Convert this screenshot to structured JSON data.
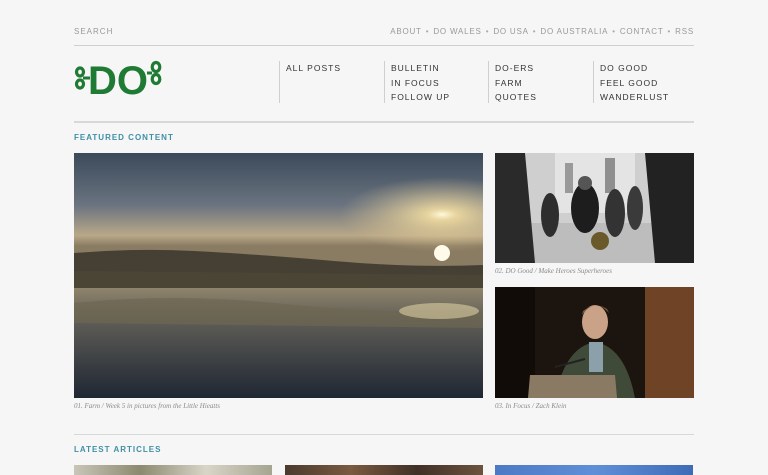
{
  "header": {
    "search_label": "SEARCH",
    "topnav": [
      "ABOUT",
      "DO WALES",
      "DO USA",
      "DO AUSTRALIA",
      "CONTACT",
      "RSS"
    ],
    "separator": "•"
  },
  "logo": {
    "text": "DO",
    "color": "#1f7a34"
  },
  "nav": {
    "col1": [
      "ALL POSTS"
    ],
    "col2": [
      "BULLETIN",
      "IN FOCUS",
      "FOLLOW UP"
    ],
    "col3": [
      "DO-ERS",
      "FARM",
      "QUOTES"
    ],
    "col4": [
      "DO GOOD",
      "FEEL GOOD",
      "WANDERLUST"
    ]
  },
  "featured": {
    "title": "FEATURED CONTENT",
    "items": [
      {
        "caption": "01. Farm / Week 5 in pictures from the Little Hieatts"
      },
      {
        "caption": "02. DO Good / Make Heroes Superheroes"
      },
      {
        "caption": "03. In Focus / Zach Klein"
      }
    ]
  },
  "latest": {
    "title": "LATEST ARTICLES"
  },
  "colors": {
    "accent": "#3f8fa6",
    "logo_green": "#1f7a34"
  }
}
